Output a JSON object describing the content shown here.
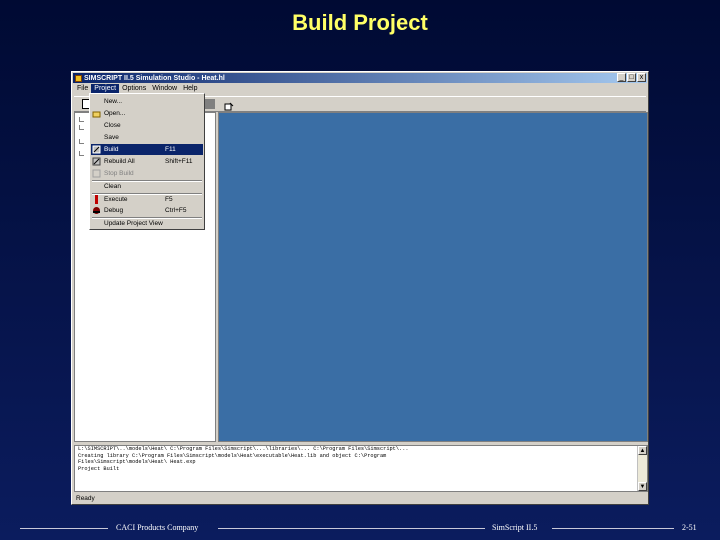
{
  "slide": {
    "title": "Build Project"
  },
  "window": {
    "title": "SIMSCRIPT II.5 Simulation Studio - Heat.hl",
    "buttons": {
      "minimize": "_",
      "maximize": "□",
      "close": "x"
    }
  },
  "menubar": {
    "items": [
      {
        "label": "File",
        "active": false
      },
      {
        "label": "Project",
        "active": true
      },
      {
        "label": "Options",
        "active": false
      },
      {
        "label": "Window",
        "active": false
      },
      {
        "label": "Help",
        "active": false
      }
    ]
  },
  "project_menu": {
    "items": [
      {
        "label": "New...",
        "shortcut": "",
        "icon": "",
        "state": "normal"
      },
      {
        "label": "Open...",
        "shortcut": "",
        "icon": "open-project-icon",
        "state": "normal"
      },
      {
        "label": "Close",
        "shortcut": "",
        "icon": "",
        "state": "normal"
      },
      {
        "label": "Save",
        "shortcut": "",
        "icon": "",
        "state": "normal"
      },
      {
        "label": "Build",
        "shortcut": "F11",
        "icon": "build-icon",
        "state": "selected"
      },
      {
        "label": "Rebuild All",
        "shortcut": "Shift+F11",
        "icon": "rebuild-all-icon",
        "state": "normal"
      },
      {
        "label": "Stop Build",
        "shortcut": "",
        "icon": "stop-build-icon",
        "state": "disabled"
      },
      {
        "label": "Clean",
        "shortcut": "",
        "icon": "",
        "state": "normal"
      },
      {
        "label": "Execute",
        "shortcut": "F5",
        "icon": "execute-icon",
        "state": "normal"
      },
      {
        "label": "Debug",
        "shortcut": "Ctrl+F5",
        "icon": "debug-icon",
        "state": "normal"
      },
      {
        "label": "Update Project View",
        "shortcut": "",
        "icon": "",
        "state": "normal"
      }
    ]
  },
  "output": {
    "lines": [
      "L:\\SIMSCRIPT\\..\\models\\Heat\\ C:\\Program Files\\Simscript\\...\\libraries\\... C:\\Program Files\\Simscript\\...",
      "    Creating library C:\\Program Files\\Simscript\\models\\Heat\\executable\\Heat.lib and object C:\\Program",
      "Files\\Simscript\\models\\Heat\\ Heat.exp",
      "Project Built"
    ]
  },
  "statusbar": {
    "text": "Ready"
  },
  "footer": {
    "left": "CACI Products Company",
    "center": "SimScript II.5",
    "right": "2-51"
  }
}
